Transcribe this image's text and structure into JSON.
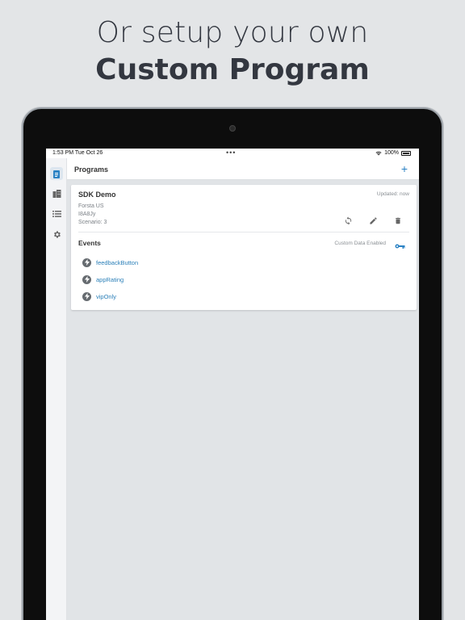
{
  "promo": {
    "line1": "Or setup your own",
    "line2": "Custom Program"
  },
  "status_bar": {
    "time": "1:53 PM   Tue Oct 26",
    "battery": "100%"
  },
  "appbar": {
    "title": "Programs",
    "add_label": "+"
  },
  "program": {
    "title": "SDK Demo",
    "updated": "Updated: now",
    "meta": [
      "Forsta US",
      "I8A8Jy",
      "Scenario: 3"
    ]
  },
  "events": {
    "title": "Events",
    "custom_data": "Custom Data Enabled",
    "items": [
      "feedbackButton",
      "appRating",
      "vipOnly"
    ]
  },
  "colors": {
    "accent": "#2b82c4",
    "link": "#2a7fb8"
  }
}
